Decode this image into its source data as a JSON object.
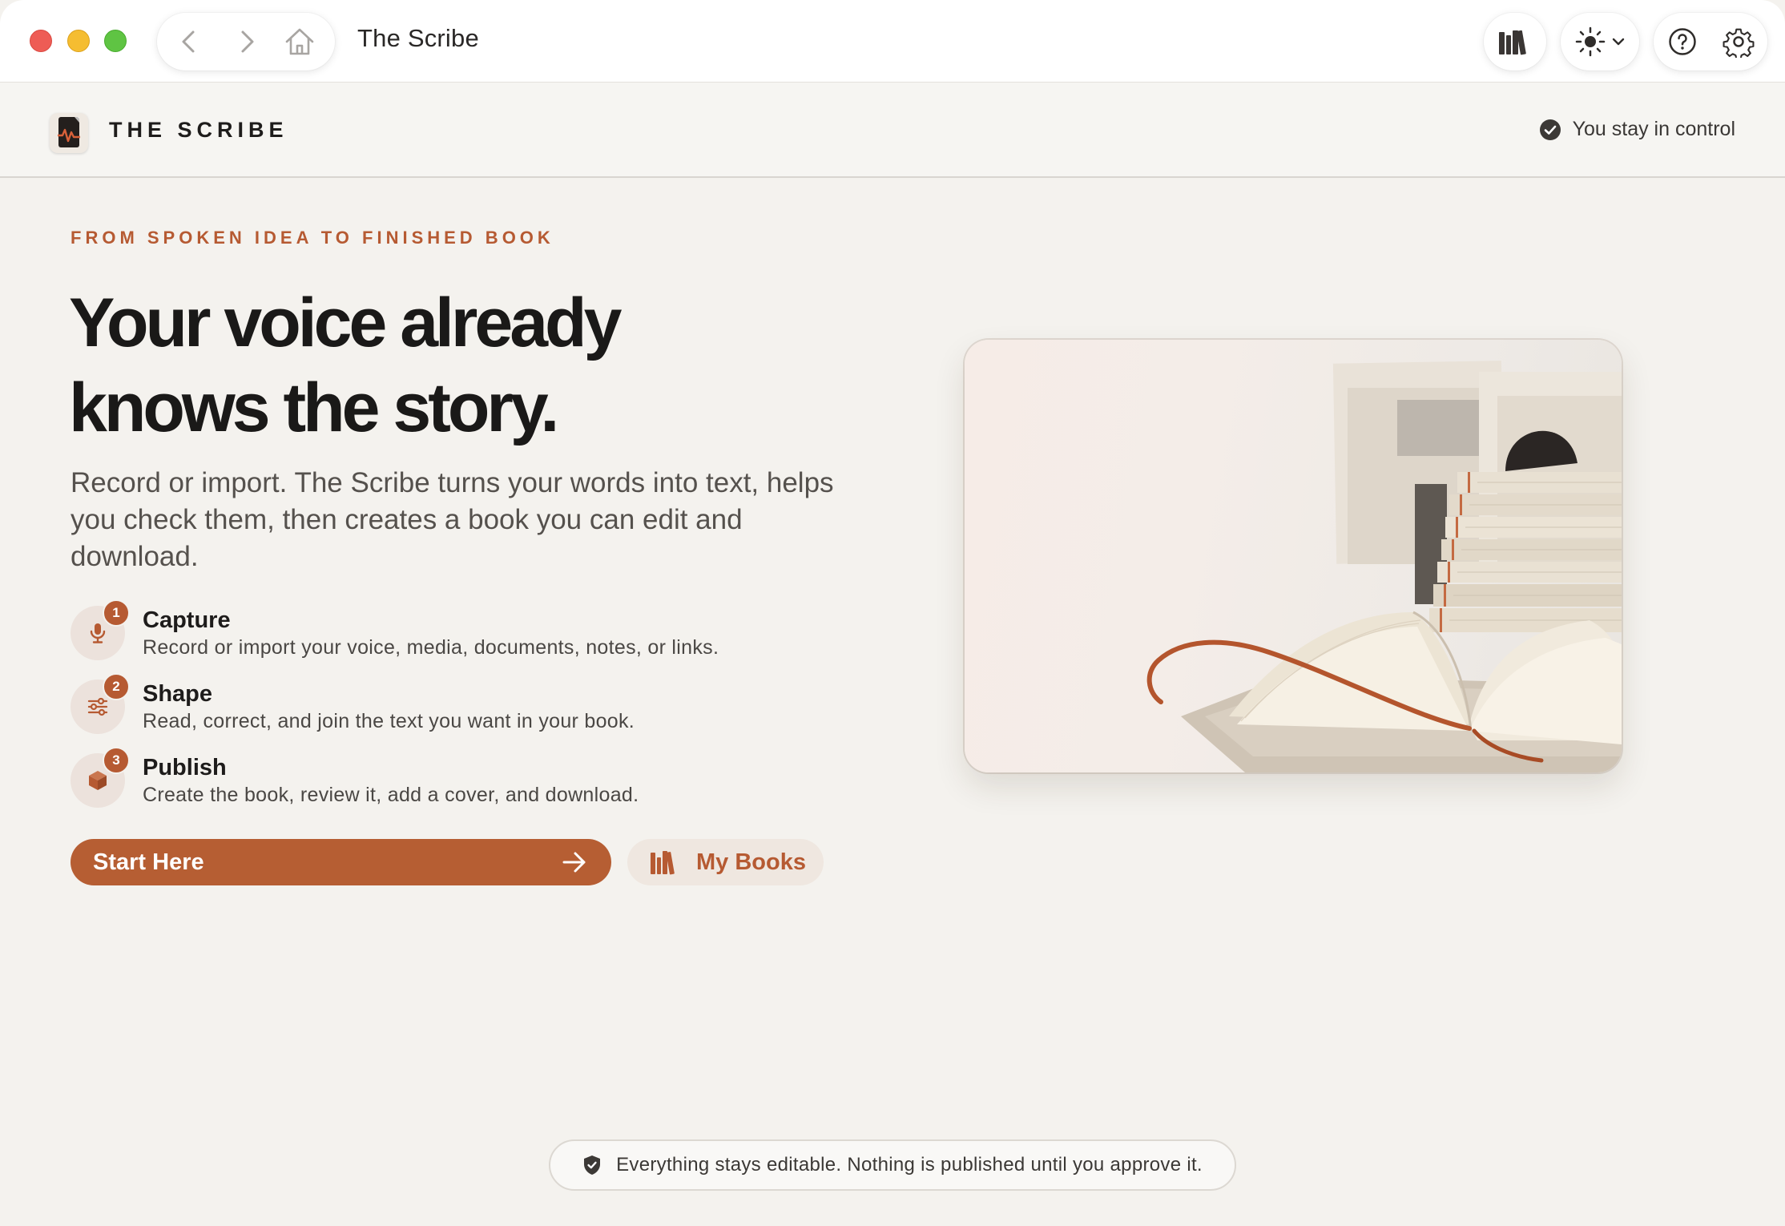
{
  "window": {
    "title": "The Scribe"
  },
  "header": {
    "app_name": "THE SCRIBE",
    "control_text": "You stay in control"
  },
  "hero": {
    "eyebrow": "FROM SPOKEN IDEA TO FINISHED BOOK",
    "headline_line1": "Your voice already",
    "headline_line2": "knows the story.",
    "lead": "Record or import. The Scribe turns your words into text, helps you check them, then creates a book you can edit and download."
  },
  "steps": [
    {
      "number": "1",
      "title": "Capture",
      "description": "Record or import your voice, media, documents, notes, or links.",
      "icon": "microphone-icon"
    },
    {
      "number": "2",
      "title": "Shape",
      "description": "Read, correct, and join the text you want in your book.",
      "icon": "sliders-icon"
    },
    {
      "number": "3",
      "title": "Publish",
      "description": "Create the book, review it, add a cover, and download.",
      "icon": "box-icon"
    }
  ],
  "actions": {
    "start_label": "Start Here",
    "books_label": "My Books"
  },
  "footer": {
    "notice": "Everything stays editable. Nothing is published until you approve it."
  },
  "colors": {
    "accent": "#b65e33",
    "background": "#f4f2ee"
  }
}
